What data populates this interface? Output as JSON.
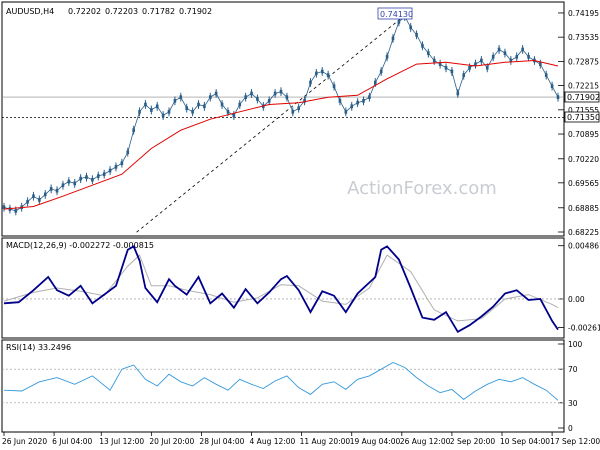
{
  "chart_data": {
    "type": "line",
    "symbol": "AUDUSD,H4",
    "ohlc": {
      "open": "0.72202",
      "high": "0.72203",
      "low": "0.71782",
      "close": "0.71902"
    },
    "watermark": "ActionForex.com",
    "price_label": "0.71902",
    "level_label": "0.71350",
    "peak_label": "0.74130",
    "price_panel": {
      "ylim": [
        0.68225,
        0.7433
      ],
      "ticks": [
        "0.74195",
        "0.73535",
        "0.72875",
        "0.72215",
        "0.71555",
        "0.70895",
        "0.70220",
        "0.69565",
        "0.68885",
        "0.68225"
      ],
      "tick_values": [
        0.74195,
        0.73535,
        0.72875,
        0.72215,
        0.71555,
        0.70895,
        0.7022,
        0.69565,
        0.68885,
        0.68225
      ],
      "price_series": [
        [
          0,
          0.689
        ],
        [
          2,
          0.6885
        ],
        [
          4,
          0.688
        ],
        [
          6,
          0.689
        ],
        [
          8,
          0.6905
        ],
        [
          10,
          0.692
        ],
        [
          12,
          0.691
        ],
        [
          14,
          0.6925
        ],
        [
          16,
          0.694
        ],
        [
          18,
          0.6935
        ],
        [
          20,
          0.695
        ],
        [
          22,
          0.696
        ],
        [
          24,
          0.6955
        ],
        [
          26,
          0.6968
        ],
        [
          28,
          0.6972
        ],
        [
          30,
          0.6965
        ],
        [
          32,
          0.6975
        ],
        [
          34,
          0.698
        ],
        [
          36,
          0.699
        ],
        [
          38,
          0.7
        ],
        [
          40,
          0.701
        ],
        [
          42,
          0.704
        ],
        [
          44,
          0.71
        ],
        [
          46,
          0.715
        ],
        [
          48,
          0.717
        ],
        [
          50,
          0.7155
        ],
        [
          52,
          0.7165
        ],
        [
          54,
          0.714
        ],
        [
          56,
          0.715
        ],
        [
          58,
          0.718
        ],
        [
          60,
          0.719
        ],
        [
          62,
          0.716
        ],
        [
          64,
          0.715
        ],
        [
          66,
          0.717
        ],
        [
          68,
          0.7165
        ],
        [
          70,
          0.719
        ],
        [
          72,
          0.72
        ],
        [
          74,
          0.717
        ],
        [
          76,
          0.715
        ],
        [
          78,
          0.714
        ],
        [
          80,
          0.717
        ],
        [
          82,
          0.719
        ],
        [
          84,
          0.72
        ],
        [
          86,
          0.7185
        ],
        [
          88,
          0.7165
        ],
        [
          90,
          0.718
        ],
        [
          92,
          0.72
        ],
        [
          94,
          0.7205
        ],
        [
          96,
          0.719
        ],
        [
          98,
          0.715
        ],
        [
          100,
          0.716
        ],
        [
          102,
          0.718
        ],
        [
          104,
          0.723
        ],
        [
          106,
          0.7255
        ],
        [
          108,
          0.726
        ],
        [
          110,
          0.725
        ],
        [
          112,
          0.722
        ],
        [
          114,
          0.718
        ],
        [
          116,
          0.715
        ],
        [
          118,
          0.7165
        ],
        [
          120,
          0.7175
        ],
        [
          122,
          0.718
        ],
        [
          124,
          0.719
        ],
        [
          126,
          0.723
        ],
        [
          128,
          0.726
        ],
        [
          130,
          0.73
        ],
        [
          132,
          0.735
        ],
        [
          134,
          0.7395
        ],
        [
          136,
          0.741
        ],
        [
          138,
          0.738
        ],
        [
          140,
          0.736
        ],
        [
          142,
          0.733
        ],
        [
          144,
          0.731
        ],
        [
          146,
          0.729
        ],
        [
          148,
          0.728
        ],
        [
          150,
          0.727
        ],
        [
          152,
          0.726
        ],
        [
          154,
          0.72
        ],
        [
          156,
          0.725
        ],
        [
          158,
          0.727
        ],
        [
          160,
          0.728
        ],
        [
          162,
          0.729
        ],
        [
          164,
          0.727
        ],
        [
          166,
          0.73
        ],
        [
          168,
          0.732
        ],
        [
          170,
          0.731
        ],
        [
          172,
          0.729
        ],
        [
          174,
          0.73
        ],
        [
          176,
          0.732
        ],
        [
          178,
          0.73
        ],
        [
          180,
          0.729
        ],
        [
          182,
          0.728
        ],
        [
          184,
          0.725
        ],
        [
          186,
          0.722
        ],
        [
          188,
          0.719
        ]
      ],
      "ma_series": [
        [
          0,
          0.6885
        ],
        [
          10,
          0.6892
        ],
        [
          20,
          0.692
        ],
        [
          30,
          0.695
        ],
        [
          40,
          0.698
        ],
        [
          50,
          0.705
        ],
        [
          60,
          0.71
        ],
        [
          70,
          0.713
        ],
        [
          80,
          0.715
        ],
        [
          90,
          0.717
        ],
        [
          100,
          0.7175
        ],
        [
          110,
          0.719
        ],
        [
          120,
          0.7195
        ],
        [
          130,
          0.724
        ],
        [
          140,
          0.728
        ],
        [
          150,
          0.7285
        ],
        [
          160,
          0.7275
        ],
        [
          170,
          0.7285
        ],
        [
          180,
          0.729
        ],
        [
          188,
          0.7275
        ]
      ]
    },
    "macd_panel": {
      "title": "MACD(12,26,9) -0.002272 -0.000815",
      "ticks": [
        "0.004861",
        "0.00",
        "-0.002611"
      ],
      "tick_values": [
        0.004861,
        0.0,
        -0.002611
      ],
      "macd_series": [
        [
          0,
          -0.0004
        ],
        [
          5,
          -0.0003
        ],
        [
          10,
          0.0008
        ],
        [
          15,
          0.002
        ],
        [
          18,
          0.0008
        ],
        [
          22,
          0.0003
        ],
        [
          26,
          0.0012
        ],
        [
          30,
          -0.0004
        ],
        [
          34,
          0.0004
        ],
        [
          38,
          0.0012
        ],
        [
          42,
          0.0045
        ],
        [
          44,
          0.0048
        ],
        [
          46,
          0.0035
        ],
        [
          48,
          0.001
        ],
        [
          52,
          -0.0003
        ],
        [
          56,
          0.0018
        ],
        [
          58,
          0.0012
        ],
        [
          62,
          0.0004
        ],
        [
          66,
          0.002
        ],
        [
          70,
          -0.0004
        ],
        [
          74,
          0.0005
        ],
        [
          78,
          -0.0008
        ],
        [
          82,
          0.0009
        ],
        [
          86,
          -0.0004
        ],
        [
          90,
          0.0006
        ],
        [
          94,
          0.0018
        ],
        [
          96,
          0.0021
        ],
        [
          100,
          0.0008
        ],
        [
          104,
          -0.0012
        ],
        [
          108,
          0.0007
        ],
        [
          112,
          0.0003
        ],
        [
          116,
          -0.0012
        ],
        [
          120,
          0.0005
        ],
        [
          124,
          0.0015
        ],
        [
          126,
          0.002
        ],
        [
          128,
          0.0045
        ],
        [
          130,
          0.0048
        ],
        [
          134,
          0.0036
        ],
        [
          138,
          0.001
        ],
        [
          142,
          -0.0017
        ],
        [
          146,
          -0.0019
        ],
        [
          150,
          -0.0012
        ],
        [
          154,
          -0.003
        ],
        [
          158,
          -0.0024
        ],
        [
          162,
          -0.0016
        ],
        [
          166,
          -0.0007
        ],
        [
          170,
          0.0005
        ],
        [
          174,
          0.0008
        ],
        [
          178,
          -0.0001
        ],
        [
          182,
          0.0
        ],
        [
          186,
          -0.002
        ],
        [
          188,
          -0.0028
        ]
      ],
      "signal_series": [
        [
          0,
          -0.0002
        ],
        [
          10,
          0.0006
        ],
        [
          18,
          0.001
        ],
        [
          26,
          0.0007
        ],
        [
          34,
          0.0003
        ],
        [
          42,
          0.003
        ],
        [
          46,
          0.004
        ],
        [
          50,
          0.0012
        ],
        [
          56,
          0.0012
        ],
        [
          62,
          0.0008
        ],
        [
          70,
          0.0004
        ],
        [
          78,
          -0.0003
        ],
        [
          86,
          0.0001
        ],
        [
          94,
          0.0013
        ],
        [
          100,
          0.0012
        ],
        [
          108,
          -0.0002
        ],
        [
          116,
          -0.0005
        ],
        [
          124,
          0.001
        ],
        [
          130,
          0.004
        ],
        [
          138,
          0.0025
        ],
        [
          146,
          -0.001
        ],
        [
          154,
          -0.002
        ],
        [
          162,
          -0.0018
        ],
        [
          170,
          0.0
        ],
        [
          178,
          0.0004
        ],
        [
          186,
          -0.0005
        ],
        [
          188,
          -0.0008
        ]
      ]
    },
    "rsi_panel": {
      "title": "RSI(14) 33.2496",
      "ticks": [
        "100",
        "70",
        "30",
        "0"
      ],
      "tick_values": [
        100,
        70,
        30,
        0
      ],
      "rsi_series": [
        [
          0,
          45
        ],
        [
          6,
          44
        ],
        [
          12,
          55
        ],
        [
          18,
          60
        ],
        [
          24,
          52
        ],
        [
          30,
          62
        ],
        [
          36,
          45
        ],
        [
          40,
          70
        ],
        [
          44,
          75
        ],
        [
          48,
          58
        ],
        [
          52,
          50
        ],
        [
          56,
          64
        ],
        [
          60,
          55
        ],
        [
          64,
          50
        ],
        [
          68,
          60
        ],
        [
          72,
          52
        ],
        [
          76,
          45
        ],
        [
          80,
          58
        ],
        [
          84,
          52
        ],
        [
          88,
          47
        ],
        [
          92,
          56
        ],
        [
          96,
          62
        ],
        [
          100,
          48
        ],
        [
          104,
          40
        ],
        [
          108,
          52
        ],
        [
          112,
          55
        ],
        [
          116,
          46
        ],
        [
          120,
          58
        ],
        [
          124,
          62
        ],
        [
          128,
          70
        ],
        [
          132,
          78
        ],
        [
          136,
          72
        ],
        [
          140,
          60
        ],
        [
          144,
          50
        ],
        [
          148,
          42
        ],
        [
          152,
          46
        ],
        [
          156,
          34
        ],
        [
          160,
          44
        ],
        [
          164,
          52
        ],
        [
          168,
          58
        ],
        [
          172,
          55
        ],
        [
          176,
          60
        ],
        [
          180,
          52
        ],
        [
          184,
          45
        ],
        [
          188,
          33
        ]
      ]
    },
    "x_labels": [
      "26 Jun 2020",
      "6 Jul 04:00",
      "13 Jul 12:00",
      "20 Jul 20:00",
      "28 Jul 04:00",
      "4 Aug 12:00",
      "11 Aug 20:00",
      "19 Aug 04:00",
      "26 Aug 12:00",
      "2 Sep 20:00",
      "10 Sep 04:00",
      "17 Sep 12:00"
    ],
    "x_label_positions": [
      0,
      17,
      33,
      50,
      67,
      84,
      101,
      118,
      135,
      152,
      169,
      186
    ],
    "colors": {
      "price": "#2a5f8a",
      "ma": "#e10000",
      "trendline": "#000000",
      "macd": "#00008b",
      "signal": "#b0b0b0",
      "rsi": "#3399dd",
      "watermark": "#c9cdd3"
    }
  }
}
